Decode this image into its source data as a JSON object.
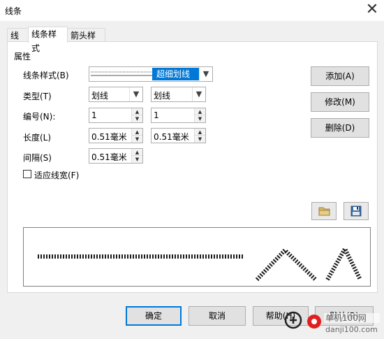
{
  "window": {
    "title": "线条",
    "close_glyph": "✕"
  },
  "tabs": [
    {
      "label": "线条",
      "active": false
    },
    {
      "label": "线条样式",
      "active": true
    },
    {
      "label": "箭头样式",
      "active": false
    }
  ],
  "properties": {
    "section_title": "属性",
    "line_style": {
      "label": "线条样式(B)",
      "value": "超细划线"
    },
    "type": {
      "label": "类型(T)",
      "value1": "划线",
      "value2": "划线"
    },
    "number": {
      "label": "编号(N):",
      "value1": "1",
      "value2": "1"
    },
    "length": {
      "label": "长度(L)",
      "value1": "0.51毫米",
      "value2": "0.51毫米"
    },
    "spacing": {
      "label": "间隔(S)",
      "value": "0.51毫米"
    },
    "fit_width": {
      "label": "适应线宽(F)",
      "checked": false
    }
  },
  "side_buttons": {
    "add": "添加(A)",
    "modify": "修改(M)",
    "delete": "删除(D)"
  },
  "icons": {
    "load": "folder-icon",
    "save": "save-icon"
  },
  "footer": {
    "ok": "确定",
    "cancel": "取消",
    "help": "帮助(H)",
    "reset": "默认(R)"
  },
  "watermark": {
    "site": "danji100.com",
    "name": "单机100网"
  },
  "colors": {
    "accent": "#0078d7",
    "selection": "#0078d7"
  }
}
